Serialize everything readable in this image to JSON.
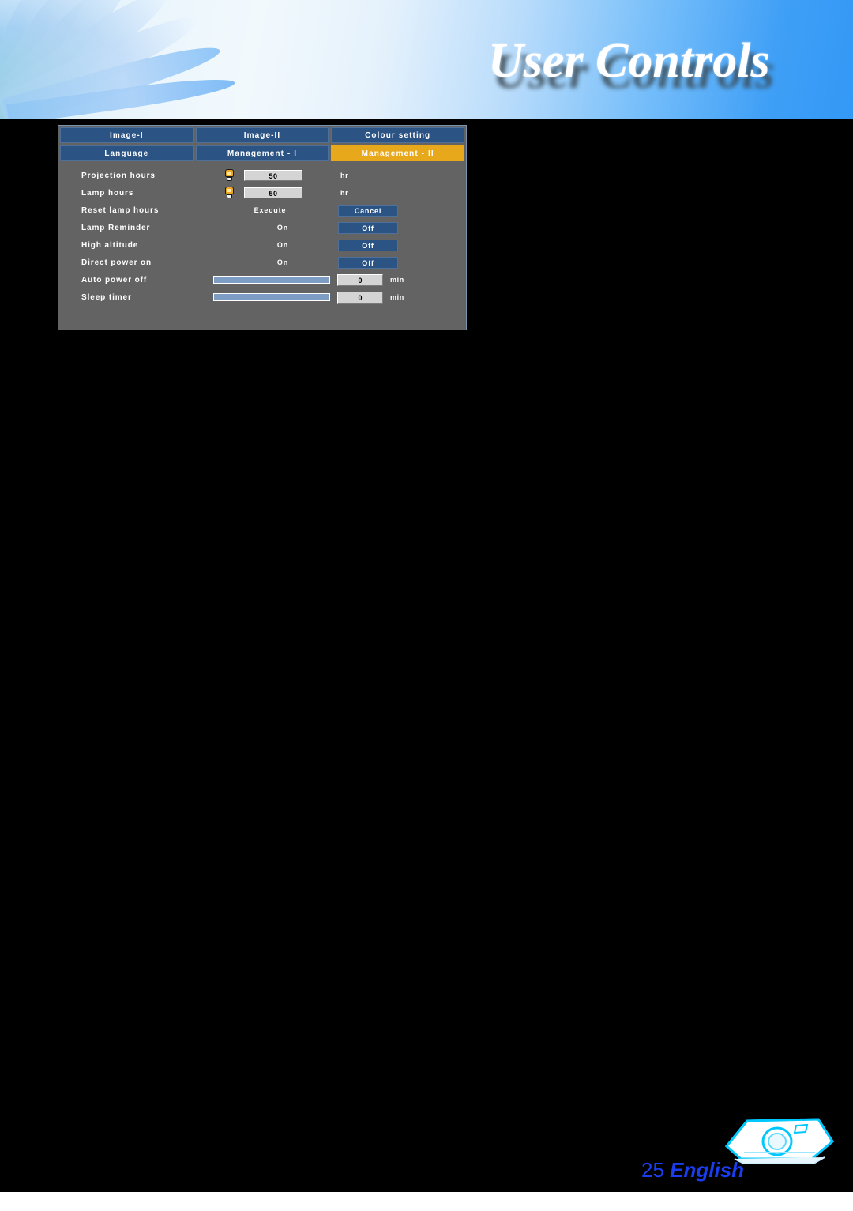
{
  "banner": {
    "title": "User Controls"
  },
  "osd": {
    "tab_rows": [
      [
        {
          "label": "Image-I",
          "active": false,
          "name": "tab-image-i"
        },
        {
          "label": "Image-II",
          "active": false,
          "name": "tab-image-ii"
        },
        {
          "label": "Colour setting",
          "active": false,
          "name": "tab-colour-setting"
        }
      ],
      [
        {
          "label": "Language",
          "active": false,
          "name": "tab-language"
        },
        {
          "label": "Management - I",
          "active": false,
          "name": "tab-management-i"
        },
        {
          "label": "Management - II",
          "active": true,
          "name": "tab-management-ii"
        }
      ]
    ],
    "rows": [
      {
        "name": "projection-hours",
        "label": "Projection hours",
        "type": "lamp-value",
        "icon": "lamp-icon",
        "value": "50",
        "unit": "hr"
      },
      {
        "name": "lamp-hours",
        "label": "Lamp hours",
        "type": "lamp-value",
        "icon": "lamp-icon",
        "value": "50",
        "unit": "hr"
      },
      {
        "name": "reset-lamp-hours",
        "label": "Reset lamp hours",
        "type": "text-button",
        "mid_text": "Execute",
        "button_label": "Cancel"
      },
      {
        "name": "lamp-reminder",
        "label": "Lamp Reminder",
        "type": "text-button",
        "mid_text": "On",
        "button_label": "Off"
      },
      {
        "name": "high-altitude",
        "label": "High altitude",
        "type": "text-button",
        "mid_text": "On",
        "button_label": "Off"
      },
      {
        "name": "direct-power-on",
        "label": "Direct power on",
        "type": "text-button",
        "mid_text": "On",
        "button_label": "Off"
      },
      {
        "name": "auto-power-off",
        "label": "Auto power off",
        "type": "slider",
        "value": "0",
        "unit": "min",
        "fill_percent": 100
      },
      {
        "name": "sleep-timer",
        "label": "Sleep timer",
        "type": "slider",
        "value": "0",
        "unit": "min",
        "fill_percent": 100
      }
    ]
  },
  "footer": {
    "page_number": "25",
    "language": "English",
    "icon": "projector-icon"
  },
  "colors": {
    "tab_blue": "#2b5484",
    "tab_active_yellow": "#e8a81c",
    "panel_grey": "#636363",
    "slider_fill": "#7d9dc4",
    "footer_blue": "#1a3df0",
    "projector_cyan": "#00c8ff"
  }
}
